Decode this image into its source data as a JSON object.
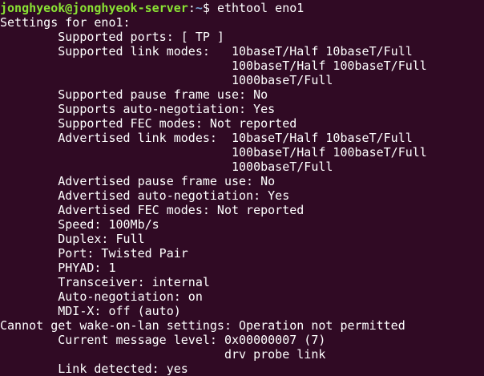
{
  "prompt": {
    "user_host": "jonghyeok@jonghyeok-server",
    "separator": ":",
    "path": "~",
    "symbol": "$ ",
    "command": "ethtool eno1"
  },
  "output": [
    "Settings for eno1:",
    "        Supported ports: [ TP ]",
    "        Supported link modes:   10baseT/Half 10baseT/Full",
    "                                100baseT/Half 100baseT/Full",
    "                                1000baseT/Full",
    "        Supported pause frame use: No",
    "        Supports auto-negotiation: Yes",
    "        Supported FEC modes: Not reported",
    "        Advertised link modes:  10baseT/Half 10baseT/Full",
    "                                100baseT/Half 100baseT/Full",
    "                                1000baseT/Full",
    "        Advertised pause frame use: No",
    "        Advertised auto-negotiation: Yes",
    "        Advertised FEC modes: Not reported",
    "        Speed: 100Mb/s",
    "        Duplex: Full",
    "        Port: Twisted Pair",
    "        PHYAD: 1",
    "        Transceiver: internal",
    "        Auto-negotiation: on",
    "        MDI-X: off (auto)",
    "Cannot get wake-on-lan settings: Operation not permitted",
    "        Current message level: 0x00000007 (7)",
    "                               drv probe link",
    "        Link detected: yes"
  ],
  "colors": {
    "background": "#300a24",
    "text": "#ffffff",
    "user_host": "#8ae234",
    "path": "#729fcf"
  }
}
